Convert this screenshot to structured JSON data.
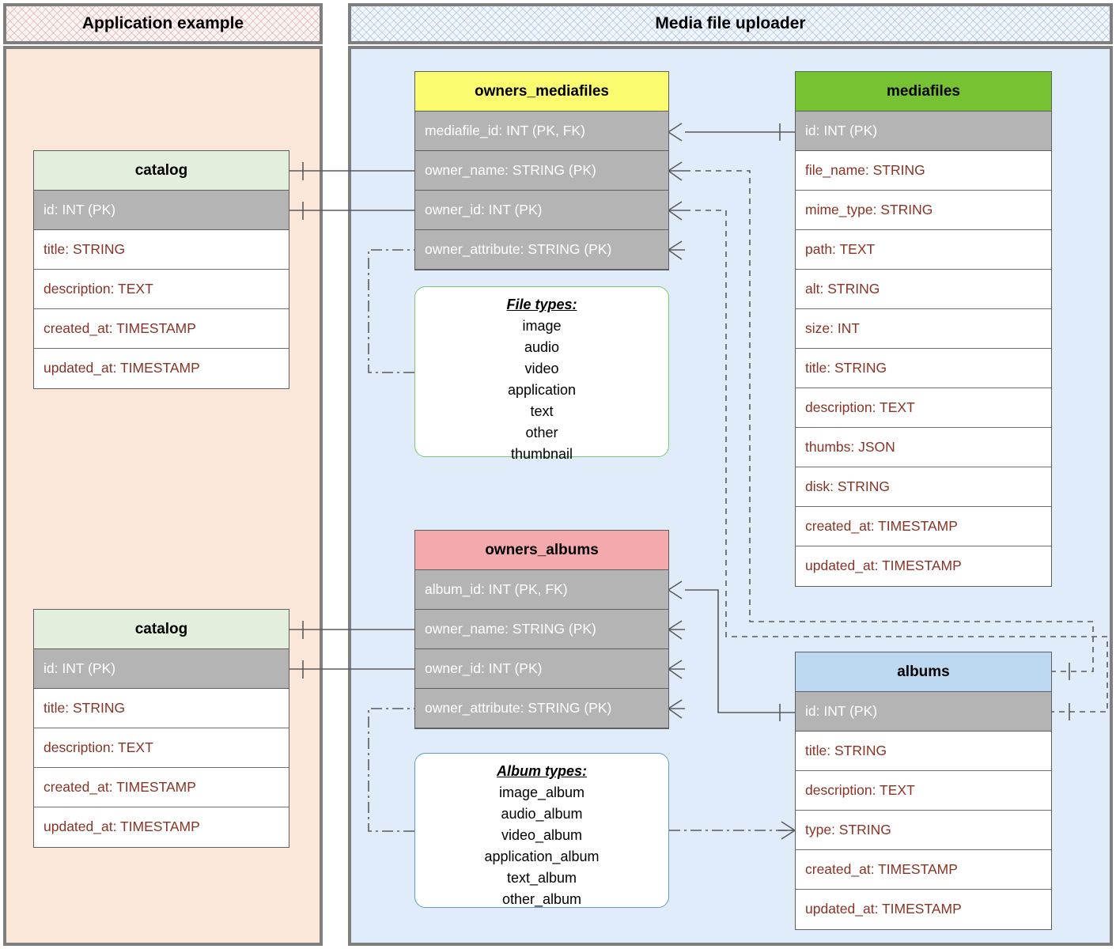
{
  "panels": {
    "left": {
      "title": "Application example"
    },
    "right": {
      "title": "Media file uploader"
    }
  },
  "colors": {
    "panel_border": "#7f7f7f",
    "left_body": "#fbe7da",
    "right_body": "#e0ecf9",
    "pk_row": "#b4b4b4",
    "field_text": "#8a3324",
    "catalog_header": "#e4eedc",
    "owners_mediafiles_header": "#fbfb70",
    "mediafiles_header": "#76c232",
    "owners_albums_header": "#f4a9ad",
    "albums_header": "#bcd8f0",
    "file_types_border": "#7bc96f",
    "album_types_border": "#5b9bd5"
  },
  "tables": {
    "catalog_top": {
      "name": "catalog",
      "fields": [
        {
          "label": "id: INT  (PK)",
          "pk": true
        },
        {
          "label": "title: STRING",
          "pk": false
        },
        {
          "label": "description: TEXT",
          "pk": false
        },
        {
          "label": "created_at: TIMESTAMP",
          "pk": false
        },
        {
          "label": "updated_at: TIMESTAMP",
          "pk": false
        }
      ]
    },
    "catalog_bottom": {
      "name": "catalog",
      "fields": [
        {
          "label": "id: INT  (PK)",
          "pk": true
        },
        {
          "label": "title: STRING",
          "pk": false
        },
        {
          "label": "description: TEXT",
          "pk": false
        },
        {
          "label": "created_at: TIMESTAMP",
          "pk": false
        },
        {
          "label": "updated_at: TIMESTAMP",
          "pk": false
        }
      ]
    },
    "owners_mediafiles": {
      "name": "owners_mediafiles",
      "fields": [
        {
          "label": "mediafile_id: INT (PK, FK)",
          "pk": true
        },
        {
          "label": "owner_name: STRING (PK)",
          "pk": true
        },
        {
          "label": "owner_id: INT (PK)",
          "pk": true
        },
        {
          "label": "owner_attribute: STRING (PK)",
          "pk": true
        }
      ]
    },
    "mediafiles": {
      "name": "mediafiles",
      "fields": [
        {
          "label": "id: INT  (PK)",
          "pk": true
        },
        {
          "label": "file_name: STRING",
          "pk": false
        },
        {
          "label": "mime_type: STRING",
          "pk": false
        },
        {
          "label": "path: TEXT",
          "pk": false
        },
        {
          "label": "alt: STRING",
          "pk": false
        },
        {
          "label": "size: INT",
          "pk": false
        },
        {
          "label": "title: STRING",
          "pk": false
        },
        {
          "label": "description: TEXT",
          "pk": false
        },
        {
          "label": "thumbs: JSON",
          "pk": false
        },
        {
          "label": "disk: STRING",
          "pk": false
        },
        {
          "label": "created_at: TIMESTAMP",
          "pk": false
        },
        {
          "label": "updated_at: TIMESTAMP",
          "pk": false
        }
      ]
    },
    "owners_albums": {
      "name": "owners_albums",
      "fields": [
        {
          "label": "album_id: INT (PK, FK)",
          "pk": true
        },
        {
          "label": "owner_name: STRING (PK)",
          "pk": true
        },
        {
          "label": "owner_id: INT (PK)",
          "pk": true
        },
        {
          "label": "owner_attribute: STRING (PK)",
          "pk": true
        }
      ]
    },
    "albums": {
      "name": "albums",
      "fields": [
        {
          "label": "id: INT  (PK)",
          "pk": true
        },
        {
          "label": "title: STRING",
          "pk": false
        },
        {
          "label": "description: TEXT",
          "pk": false
        },
        {
          "label": "type: STRING",
          "pk": false
        },
        {
          "label": "created_at: TIMESTAMP",
          "pk": false
        },
        {
          "label": "updated_at: TIMESTAMP",
          "pk": false
        }
      ]
    }
  },
  "notes": {
    "file_types": {
      "title": "File types:",
      "items": [
        "image",
        "audio",
        "video",
        "application",
        "text",
        "other",
        "thumbnail"
      ]
    },
    "album_types": {
      "title": "Album types:",
      "items": [
        "image_album",
        "audio_album",
        "video_album",
        "application_album",
        "text_album",
        "other_album"
      ]
    }
  }
}
